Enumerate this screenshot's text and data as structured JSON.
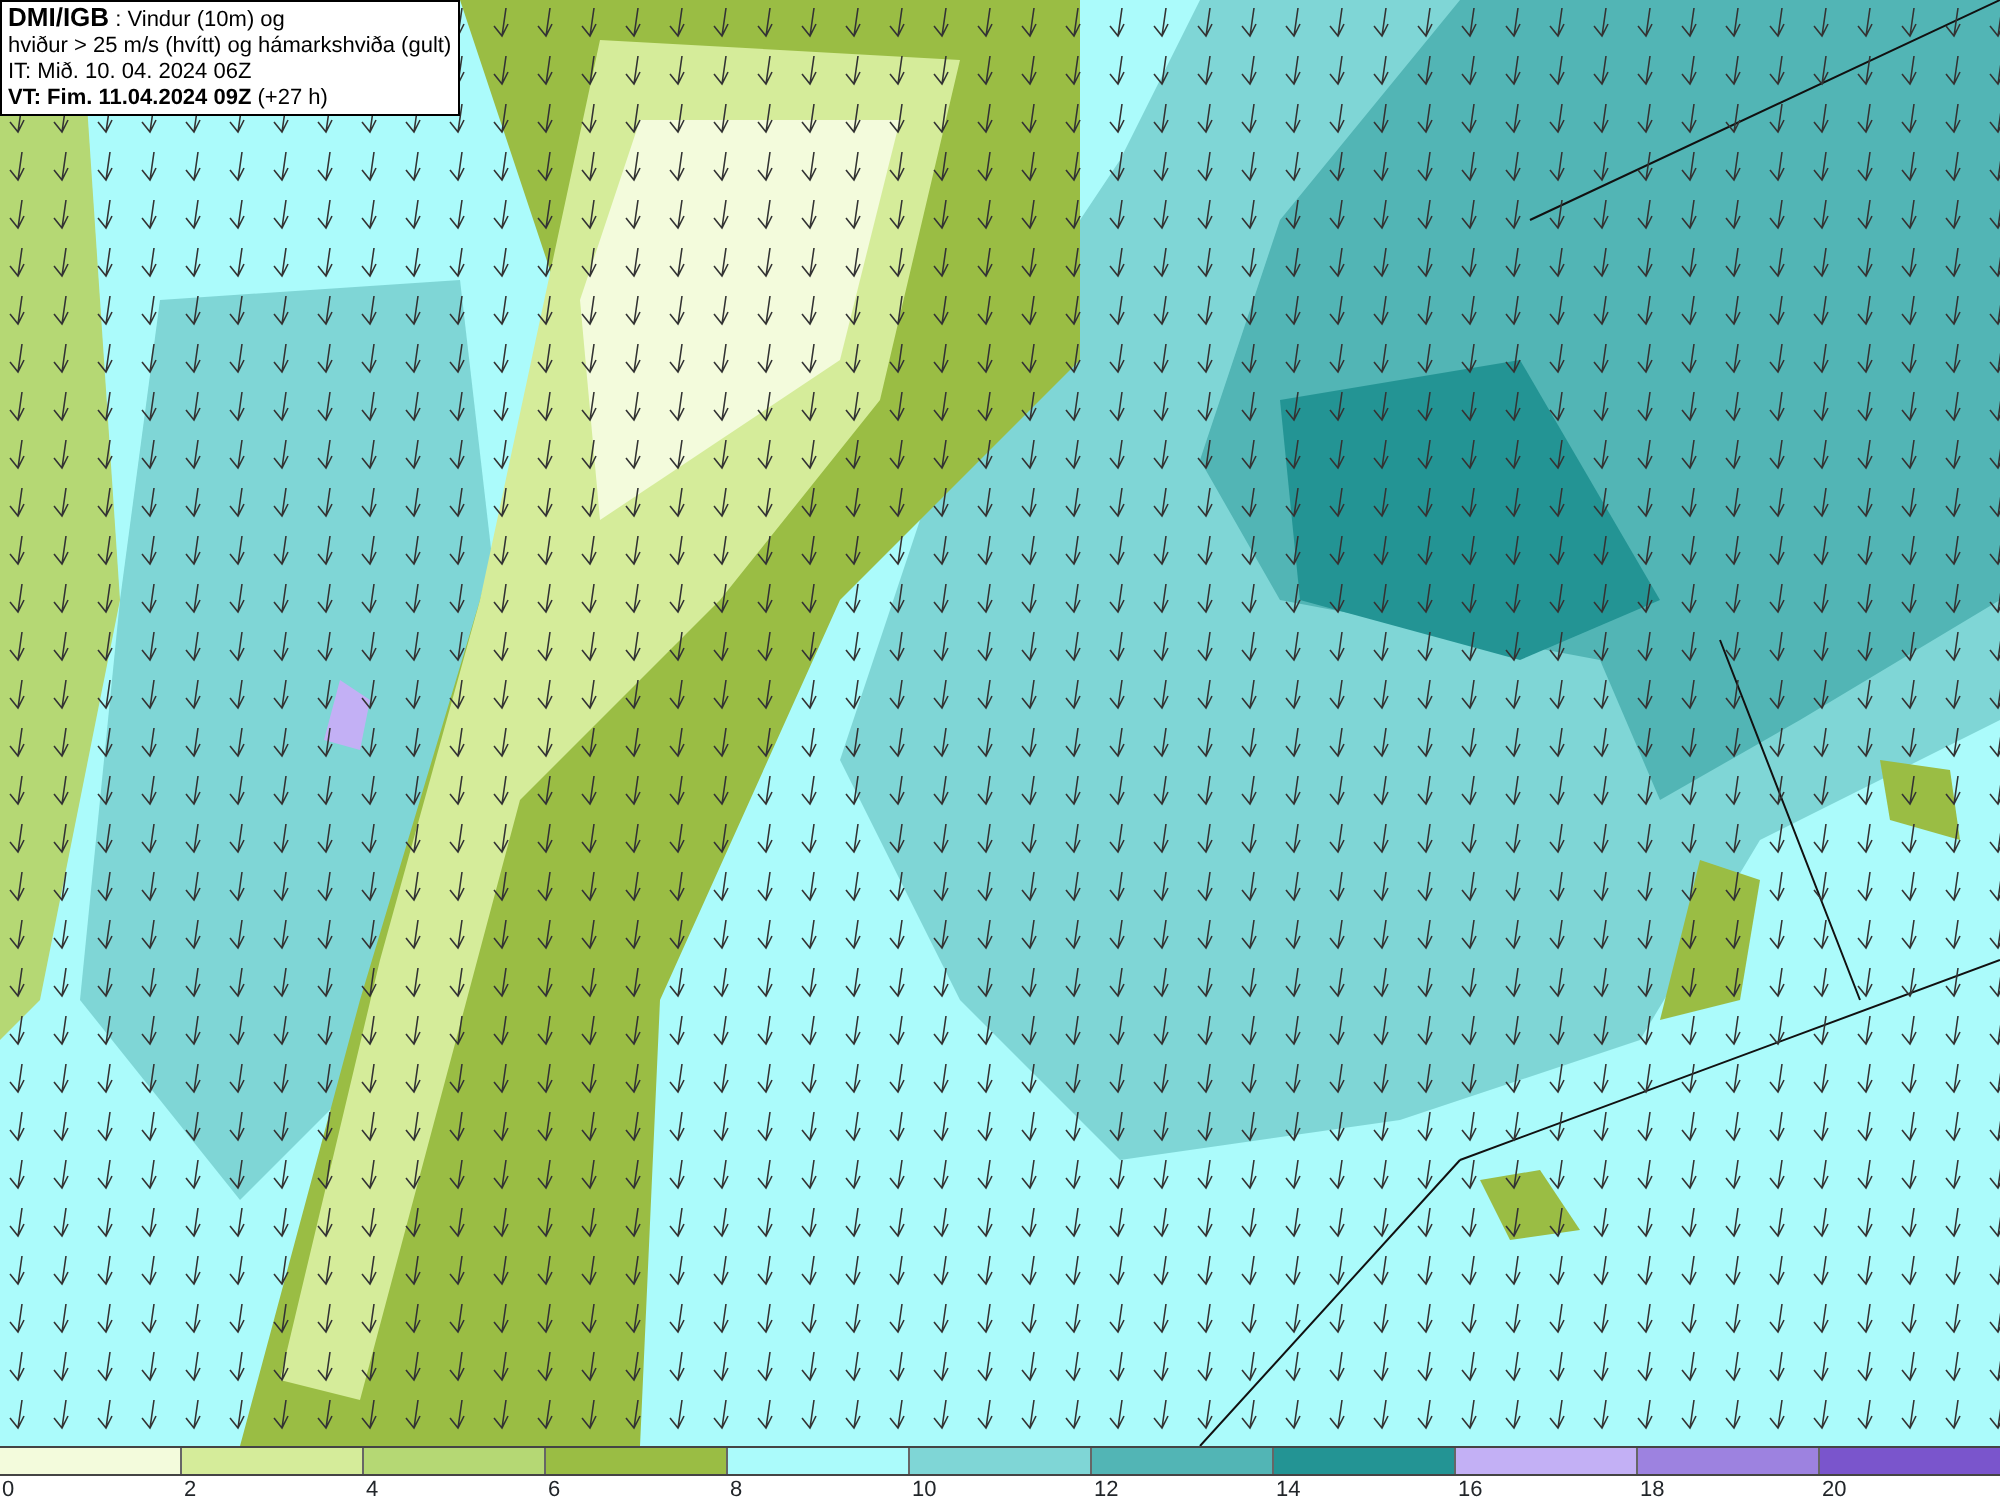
{
  "info_box": {
    "lines": [
      "**DMI/IGB** : Vindur (10m) og",
      "hviður > 25 m/s (hvítt) og hámarkshviða (gult)",
      "IT: Mið. 10. 04. 2024 06Z",
      "**VT: Fim. 11.04.2024 09Z** (+27 h)"
    ]
  },
  "legend": {
    "bins": [
      {
        "color": "#f3fbdc"
      },
      {
        "color": "#d5ec9a"
      },
      {
        "color": "#b5d874"
      },
      {
        "color": "#9abd44"
      },
      {
        "color": "#abfbfb"
      },
      {
        "color": "#7fd6d6"
      },
      {
        "color": "#52b5b5"
      },
      {
        "color": "#239494"
      },
      {
        "color": "#c3b0f5"
      },
      {
        "color": "#9d82e0"
      },
      {
        "color": "#7a55cc"
      }
    ],
    "ticks": [
      "0",
      "2",
      "4",
      "6",
      "8",
      "10",
      "12",
      "14",
      "16",
      "18",
      "20"
    ]
  }
}
